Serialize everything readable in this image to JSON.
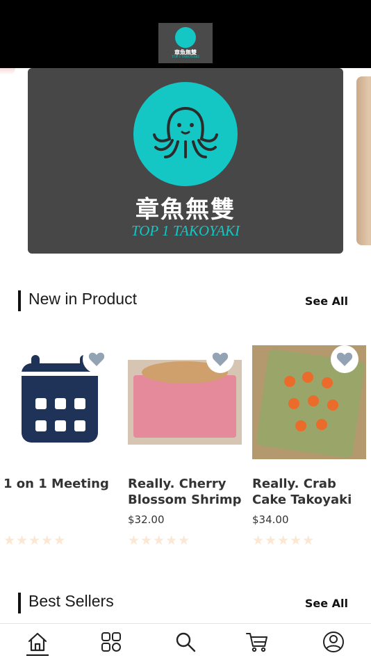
{
  "header": {
    "logo_cn": "章魚無雙",
    "logo_en": "TOP 1 TAKOYAKI"
  },
  "banner": {
    "brand_cn": "章魚無雙",
    "brand_en": "TOP 1 TAKOYAKI",
    "colors": {
      "background": "#474747",
      "accent": "#14c6c4"
    }
  },
  "new_in": {
    "title": "New in Product",
    "see_all": "See All",
    "products": [
      {
        "name": "1 on 1 Meeting",
        "price": "",
        "icon": "calendar-icon",
        "rating": 0
      },
      {
        "name": "Really. Cherry Blossom Shrimp",
        "price": "$32.00",
        "rating": 0
      },
      {
        "name": "Really. Crab Cake Takoyaki",
        "price": "$34.00",
        "rating": 0
      }
    ],
    "stars": "★★★★★"
  },
  "best_sellers": {
    "title": "Best Sellers",
    "see_all": "See All"
  },
  "nav": {
    "items": [
      "home-icon",
      "grid-icon",
      "search-icon",
      "cart-icon",
      "profile-icon"
    ],
    "active": "home-icon"
  }
}
